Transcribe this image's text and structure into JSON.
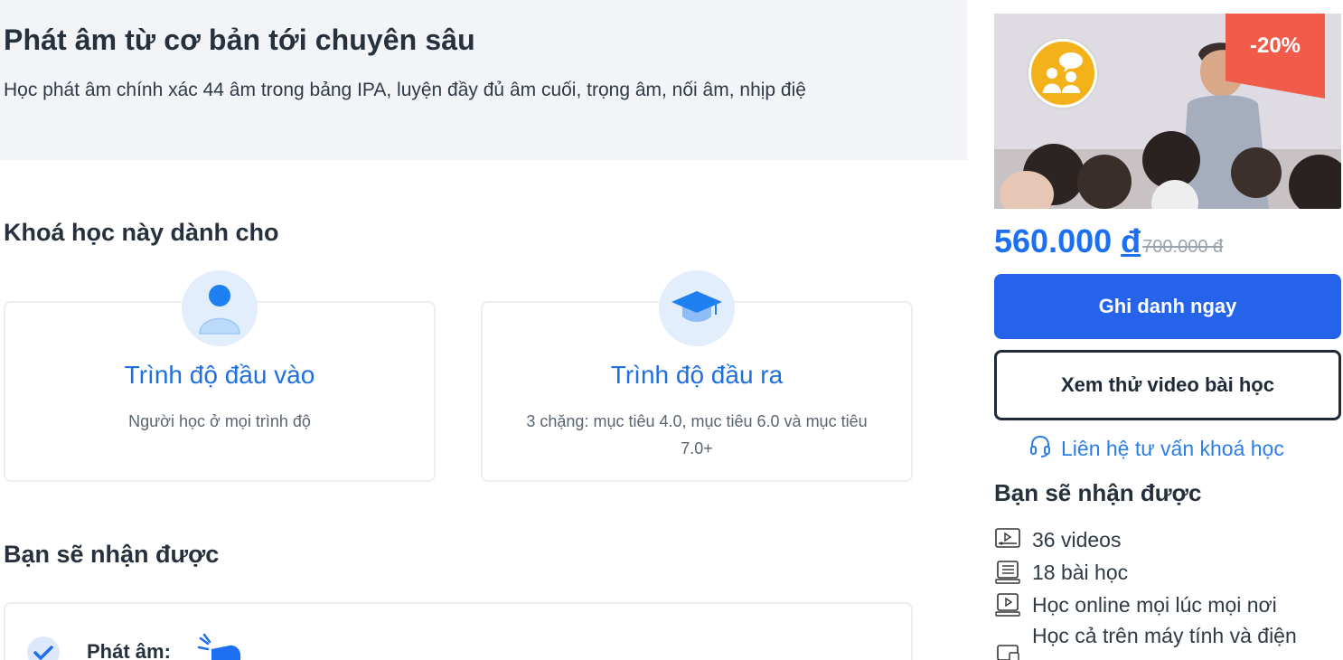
{
  "hero": {
    "title": "Phát âm từ cơ bản tới chuyên sâu",
    "description": "Học phát âm chính xác 44 âm trong bảng IPA, luyện đầy đủ âm cuối, trọng âm, nối âm, nhịp điệ"
  },
  "audience": {
    "heading": "Khoá học này dành cho",
    "cards": [
      {
        "title": "Trình độ đầu vào",
        "desc": "Người học ở mọi trình độ",
        "icon": "user-icon"
      },
      {
        "title": "Trình độ đầu ra",
        "desc": "3 chặng: mục tiêu 4.0, mục tiêu 6.0 và mục tiêu 7.0+",
        "icon": "graduation-cap-icon"
      }
    ]
  },
  "benefits": {
    "heading": "Bạn sẽ nhận được",
    "items": [
      {
        "label": "Phát âm:"
      }
    ]
  },
  "sidebar": {
    "discount": "-20%",
    "price": "560.000",
    "currency": "đ",
    "old_price": "700.000 đ",
    "enroll_label": "Ghi danh ngay",
    "preview_label": "Xem thử video bài học",
    "contact_label": "Liên hệ tư vấn khoá học",
    "receive_heading": "Bạn sẽ nhận được",
    "features": [
      {
        "icon": "video-icon",
        "label": "36 videos"
      },
      {
        "icon": "lesson-list-icon",
        "label": "18 bài học"
      },
      {
        "icon": "online-play-icon",
        "label": "Học online mọi lúc mọi nơi"
      },
      {
        "icon": "devices-icon",
        "label": "Học cả trên máy tính và điện"
      }
    ]
  },
  "colors": {
    "accent": "#2563eb",
    "link": "#2b7de9",
    "discount": "#f15b4a",
    "hero_bg": "#f3f4f8"
  }
}
